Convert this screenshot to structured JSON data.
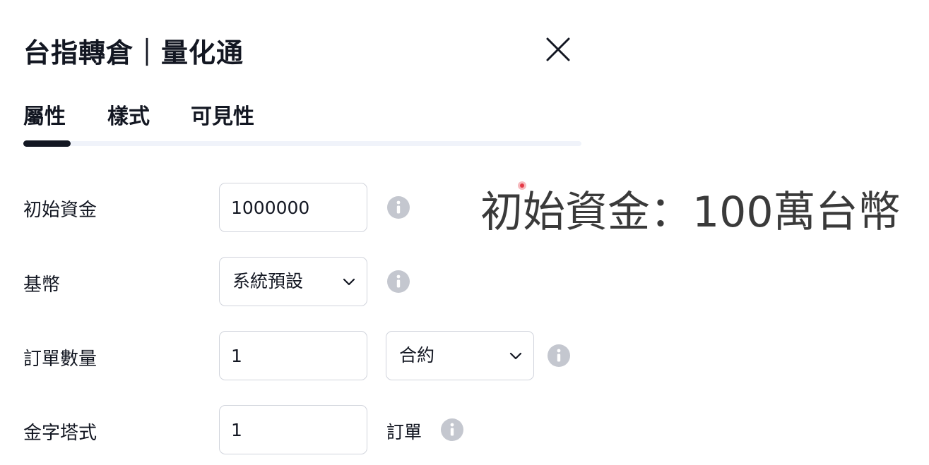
{
  "dialog": {
    "title": "台指轉倉｜量化通"
  },
  "tabs": [
    {
      "label": "屬性",
      "active": true
    },
    {
      "label": "樣式",
      "active": false
    },
    {
      "label": "可見性",
      "active": false
    }
  ],
  "form": {
    "initial_capital": {
      "label": "初始資金",
      "value": "1000000"
    },
    "base_currency": {
      "label": "基幣",
      "selected": "系統預設"
    },
    "order_size": {
      "label": "訂單數量",
      "value": "1",
      "unit_selected": "合約"
    },
    "pyramiding": {
      "label": "金字塔式",
      "value": "1",
      "suffix": "訂單"
    }
  },
  "overlay": {
    "caption": "初始資金：100萬台幣"
  },
  "icons": {
    "close": "close-icon",
    "info": "info-icon",
    "chevron": "chevron-down-icon"
  },
  "colors": {
    "text": "#131722",
    "border": "#d1d4dc",
    "info_icon": "#c4c7cf",
    "tab_track": "#f0f3fa",
    "cursor": "#e53946"
  }
}
